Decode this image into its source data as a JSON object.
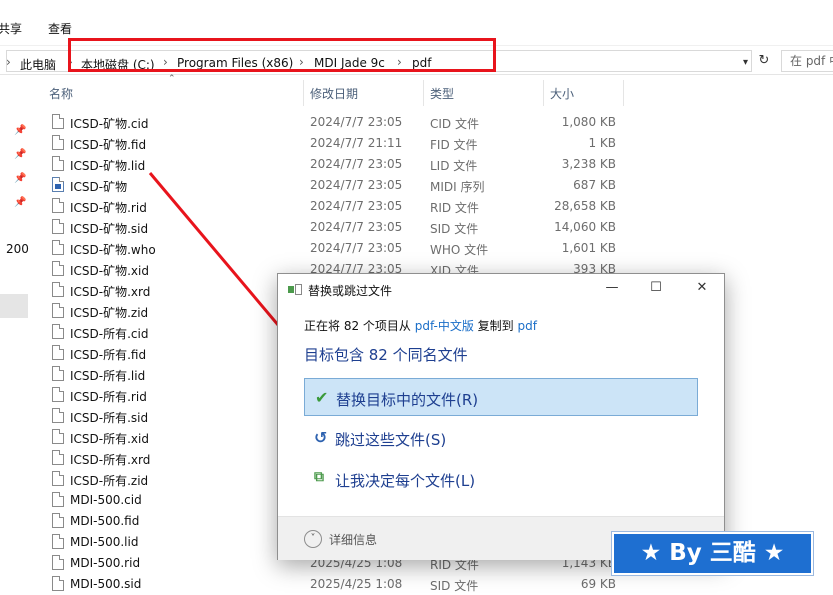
{
  "menu": {
    "share": "共享",
    "view": "查看"
  },
  "address": {
    "this_pc": "此电脑",
    "crumbs": [
      "本地磁盘 (C:)",
      "Program Files (x86)",
      "MDI Jade 9c",
      "pdf"
    ],
    "search_placeholder": "在 pdf 中搜索"
  },
  "nav": {
    "partial_item": "200"
  },
  "columns": {
    "name": "名称",
    "date": "修改日期",
    "type": "类型",
    "size": "大小"
  },
  "files": [
    {
      "name": "ICSD-矿物.cid",
      "date": "2024/7/7 23:05",
      "type": "CID 文件",
      "size": "1,080 KB",
      "icon": "file-icon"
    },
    {
      "name": "ICSD-矿物.fid",
      "date": "2024/7/7 21:11",
      "type": "FID 文件",
      "size": "1 KB",
      "icon": "file-icon"
    },
    {
      "name": "ICSD-矿物.lid",
      "date": "2024/7/7 23:05",
      "type": "LID 文件",
      "size": "3,238 KB",
      "icon": "file-icon"
    },
    {
      "name": "ICSD-矿物",
      "date": "2024/7/7 23:05",
      "type": "MIDI 序列",
      "size": "687 KB",
      "icon": "midi-file-icon"
    },
    {
      "name": "ICSD-矿物.rid",
      "date": "2024/7/7 23:05",
      "type": "RID 文件",
      "size": "28,658 KB",
      "icon": "file-icon"
    },
    {
      "name": "ICSD-矿物.sid",
      "date": "2024/7/7 23:05",
      "type": "SID 文件",
      "size": "14,060 KB",
      "icon": "file-icon"
    },
    {
      "name": "ICSD-矿物.who",
      "date": "2024/7/7 23:05",
      "type": "WHO 文件",
      "size": "1,601 KB",
      "icon": "file-icon"
    },
    {
      "name": "ICSD-矿物.xid",
      "date": "2024/7/7 23:05",
      "type": "XID 文件",
      "size": "393 KB",
      "icon": "file-icon"
    },
    {
      "name": "ICSD-矿物.xrd",
      "date": "",
      "type": "",
      "size": "",
      "icon": "file-icon"
    },
    {
      "name": "ICSD-矿物.zid",
      "date": "",
      "type": "",
      "size": "",
      "icon": "file-icon"
    },
    {
      "name": "ICSD-所有.cid",
      "date": "",
      "type": "",
      "size": "",
      "icon": "file-icon"
    },
    {
      "name": "ICSD-所有.fid",
      "date": "",
      "type": "",
      "size": "",
      "icon": "file-icon"
    },
    {
      "name": "ICSD-所有.lid",
      "date": "",
      "type": "",
      "size": "",
      "icon": "file-icon"
    },
    {
      "name": "ICSD-所有.rid",
      "date": "",
      "type": "",
      "size": "",
      "icon": "file-icon"
    },
    {
      "name": "ICSD-所有.sid",
      "date": "",
      "type": "",
      "size": "",
      "icon": "file-icon"
    },
    {
      "name": "ICSD-所有.xid",
      "date": "",
      "type": "",
      "size": "",
      "icon": "file-icon"
    },
    {
      "name": "ICSD-所有.xrd",
      "date": "",
      "type": "",
      "size": "",
      "icon": "file-icon"
    },
    {
      "name": "ICSD-所有.zid",
      "date": "",
      "type": "",
      "size": "",
      "icon": "file-icon"
    },
    {
      "name": "MDI-500.cid",
      "date": "",
      "type": "",
      "size": "",
      "icon": "file-icon"
    },
    {
      "name": "MDI-500.fid",
      "date": "",
      "type": "",
      "size": "",
      "icon": "file-icon"
    },
    {
      "name": "MDI-500.lid",
      "date": "",
      "type": "",
      "size": "",
      "icon": "file-icon"
    },
    {
      "name": "MDI-500.rid",
      "date": "2025/4/25 1:08",
      "type": "RID 文件",
      "size": "1,143 KB",
      "icon": "file-icon"
    },
    {
      "name": "MDI-500.sid",
      "date": "2025/4/25 1:08",
      "type": "SID 文件",
      "size": "69 KB",
      "icon": "file-icon"
    }
  ],
  "dialog": {
    "title": "替换或跳过文件",
    "line1": {
      "prefix": "正在将 82 个项目从 ",
      "from": "pdf-中文版",
      "middle": " 复制到 ",
      "to": "pdf"
    },
    "heading": "目标包含 82 个同名文件",
    "options": [
      {
        "label": "替换目标中的文件(R)",
        "icon": "checkmark-icon"
      },
      {
        "label": "跳过这些文件(S)",
        "icon": "skip-icon"
      },
      {
        "label": "让我决定每个文件(L)",
        "icon": "compare-files-icon"
      }
    ],
    "more_details": "详细信息",
    "controls": {
      "minimize": "—",
      "maximize": "☐",
      "close": "✕"
    },
    "accent": "#1e3f90",
    "link_color": "#1a6ec8"
  },
  "watermark": {
    "text": "★ By 三酷 ★",
    "color": "#1e6fd1"
  },
  "annotation_color": "#e8141c"
}
